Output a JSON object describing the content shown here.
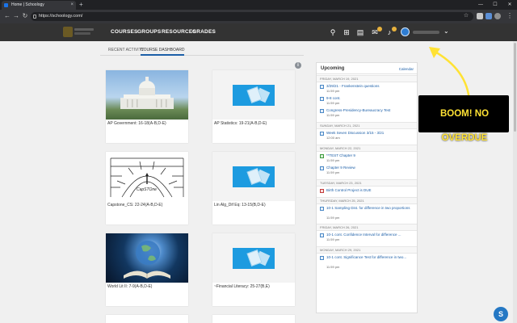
{
  "browser": {
    "tab_title": "Home | Schoology",
    "tab_close": "×",
    "new_tab": "+",
    "url": "https://schoology.com/",
    "win_minimize": "—",
    "win_maximize": "☐",
    "win_close": "✕",
    "back": "←",
    "forward": "→",
    "reload": "↻",
    "bookmark": "☆",
    "menu": "⋮"
  },
  "header": {
    "nav": [
      "COURSES",
      "GROUPS",
      "RESOURCES",
      "GRADES"
    ],
    "search_icon": "⚲",
    "grid_icon": "⊞",
    "calendar_icon": "▤",
    "mail_icon": "✉",
    "bell_icon": "♪",
    "caret": "⌄"
  },
  "subtabs": [
    "RECENT ACTIVITY",
    "COURSE DASHBOARD"
  ],
  "info_icon": "i",
  "courses": [
    {
      "title": "AP Government: 16-18(A-B,D-E)",
      "image": "capitol"
    },
    {
      "title": "AP Statistics: 19-21(A-B,D-E)",
      "image": "generic"
    },
    {
      "title": "Capstone_CS: 22-24(A-B,D-E)",
      "image": "capstone"
    },
    {
      "title": "Lin Alg_Dif Eq: 13-15(B,D-E)",
      "image": "generic"
    },
    {
      "title": "World Lit II: 7-9(A-B,D-E)",
      "image": "earth"
    },
    {
      "title": "~Financial Literacy: 25-27(B,E)",
      "image": "generic"
    }
  ],
  "capstone_label": "CapSTOne",
  "upcoming": {
    "title": "Upcoming",
    "calendar_link": "Calendar",
    "days": [
      {
        "label": "FRIDAY, MARCH 19, 2021",
        "events": [
          {
            "title": "3/29/21 - Frankenstein questions",
            "time": "11:59 pm",
            "icon": "blue"
          },
          {
            "title": "9-8 cont.",
            "time": "11:59 pm",
            "icon": "blue"
          },
          {
            "title": "Congress-Presidency-Bureaucracy Test",
            "time": "11:59 pm",
            "icon": "blue"
          }
        ]
      },
      {
        "label": "SUNDAY, MARCH 21, 2021",
        "events": [
          {
            "title": "Week Seven Discussion 3/15 - 3/21",
            "time": "12:00 am",
            "icon": "blue"
          }
        ]
      },
      {
        "label": "MONDAY, MARCH 22, 2021",
        "events": [
          {
            "title": "**TEST Chapter 9",
            "time": "11:59 pm",
            "icon": "green"
          },
          {
            "title": "Chapter 9 Review",
            "time": "11:59 pm",
            "icon": "blue"
          }
        ]
      },
      {
        "label": "TUESDAY, MARCH 23, 2021",
        "events": [
          {
            "title": "Birth Control Project is DUE",
            "time": "",
            "icon": "red"
          }
        ]
      },
      {
        "label": "THURSDAY, MARCH 25, 2021",
        "events": [
          {
            "title": "10-1 Sampling Dist. for difference in two proportions",
            "time": "11:59 pm",
            "icon": "blue",
            "two": true
          }
        ]
      },
      {
        "label": "FRIDAY, MARCH 26, 2021",
        "events": [
          {
            "title": "10-1 cont. Confidence Interval for difference ...",
            "time": "11:59 pm",
            "icon": "blue"
          }
        ]
      },
      {
        "label": "MONDAY, MARCH 29, 2021",
        "events": [
          {
            "title": "10-1 cont. Significance Test for difference in two...",
            "time": "11:59 pm",
            "icon": "blue",
            "two": true
          }
        ]
      }
    ]
  },
  "annotation": "BOOM! NO OVERDUE",
  "help_button": "S",
  "colors": {
    "header_bg": "#333333",
    "accent_blue": "#1c5fa8",
    "annotation_yellow": "#ffe234"
  }
}
